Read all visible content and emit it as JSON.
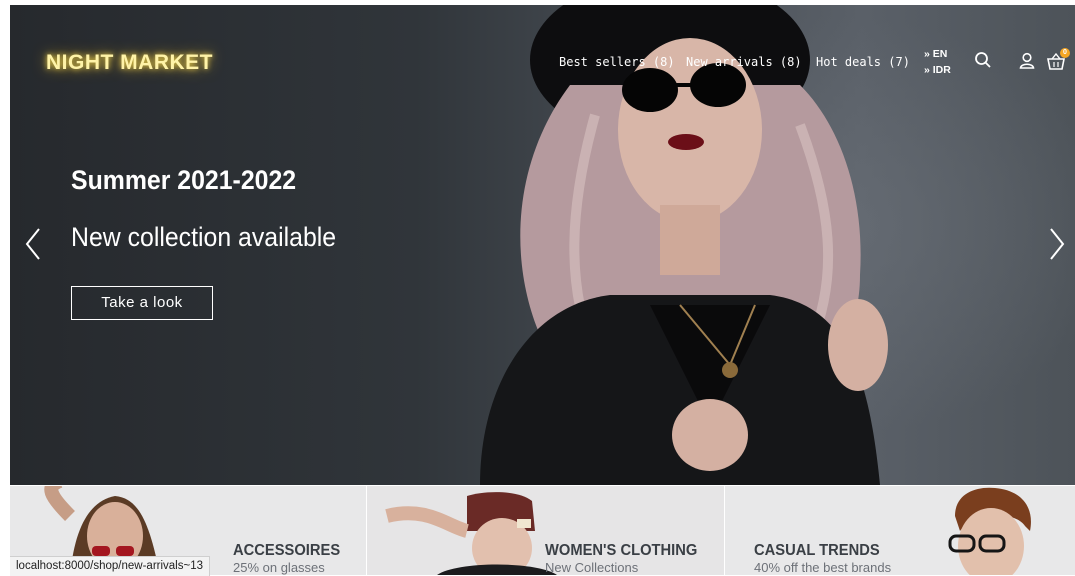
{
  "brand": {
    "logo": "NIGHT MARKET"
  },
  "nav": {
    "items": [
      {
        "label": "Best sellers (8)"
      },
      {
        "label": "New arrivals (8)"
      },
      {
        "label": "Hot deals (7)"
      }
    ],
    "languages": [
      "» EN",
      "» IDR"
    ],
    "cart_count": "0",
    "icons": [
      "search-icon",
      "user-icon",
      "cart-icon"
    ]
  },
  "hero": {
    "title": "Summer 2021-2022",
    "subtitle": "New collection available",
    "cta": "Take a look",
    "prev_icon": "chevron-left-icon",
    "next_icon": "chevron-right-icon"
  },
  "categories": [
    {
      "title": "ACCESSOIRES",
      "subtitle": "25% on glasses"
    },
    {
      "title": "WOMEN'S CLOTHING",
      "subtitle": "New Collections"
    },
    {
      "title": "CASUAL TRENDS",
      "subtitle": "40% off the best brands"
    }
  ],
  "status_bar": {
    "url": "localhost:8000/shop/new-arrivals~13"
  },
  "colors": {
    "logo_glow": "#ffd84a",
    "badge": "#f5a623",
    "banner_bg": "#e9e9ea"
  }
}
